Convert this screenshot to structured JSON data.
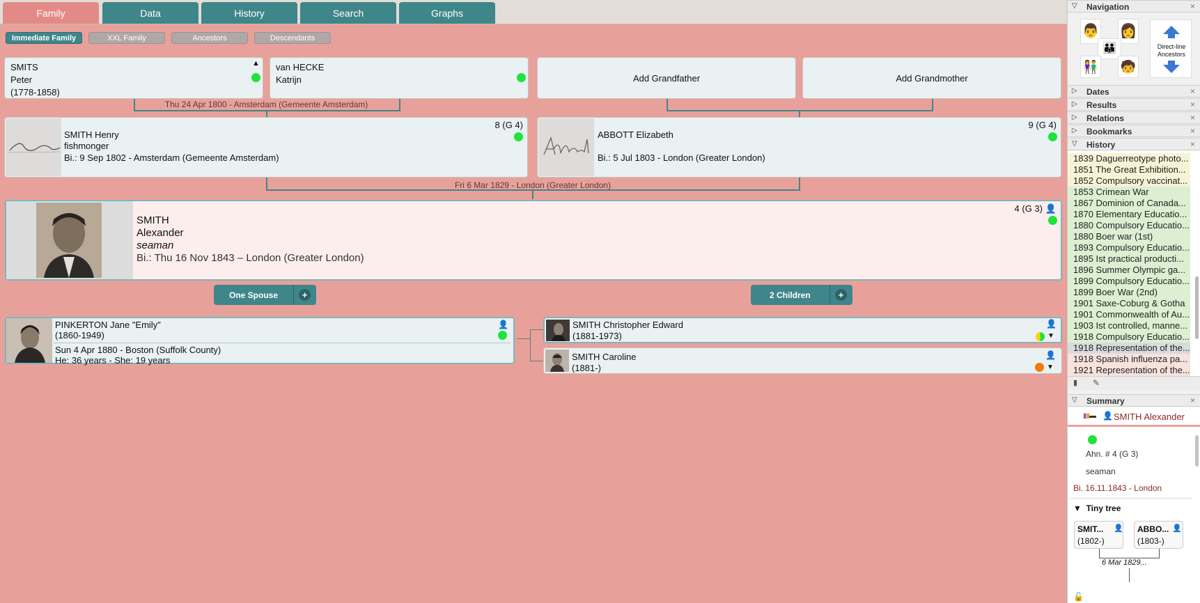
{
  "tabs": [
    "Family",
    "Data",
    "History",
    "Search",
    "Graphs"
  ],
  "subtabs": [
    "Immediate Family",
    "XXL Family",
    "Ancestors",
    "Descendants"
  ],
  "grandparents": {
    "paternal_grandfather": {
      "surname": "SMITS",
      "given": "Peter",
      "years": "(1778-1858)"
    },
    "paternal_grandmother": {
      "surname": "van HECKE",
      "given": "Katrijn"
    },
    "add_grandfather": "Add Grandfather",
    "add_grandmother": "Add Grandmother",
    "marriage": "Thu 24 Apr 1800 - Amsterdam (Gemeente Amsterdam)"
  },
  "father": {
    "name": "SMITH Henry",
    "occupation": "fishmonger",
    "birth": "Bi.: 9 Sep 1802 - Amsterdam (Gemeente Amsterdam)",
    "number": "8 (G 4)",
    "signature": "Smith"
  },
  "mother": {
    "name": "ABBOTT Elizabeth",
    "birth": "Bi.: 5 Jul 1803 - London (Greater London)",
    "number": "9 (G 4)",
    "signature": "Abbott"
  },
  "parents_marriage": "Fri 6 Mar 1829 - London (Greater London)",
  "focus": {
    "surname": "SMITH",
    "given": "Alexander",
    "occupation": "seaman",
    "birth": "Bi.: Thu 16 Nov 1843 – London (Greater London)",
    "number": "4 (G 3)"
  },
  "buttons": {
    "spouse": "One Spouse",
    "children": "2 Children",
    "plus": "+"
  },
  "spouse": {
    "name": "PINKERTON Jane \"Emily\"",
    "years": "(1860-1949)",
    "marriage": "Sun 4 Apr 1880 - Boston (Suffolk County)",
    "ages": "He: 36 years - She: 19 years"
  },
  "children": [
    {
      "name": "SMITH Christopher Edward",
      "years": "(1881-1973)"
    },
    {
      "name": "SMITH Caroline",
      "years": "(1881-)"
    }
  ],
  "side": {
    "navigation": "Navigation",
    "direct_line": "Direct-line Ancestors",
    "dates": "Dates",
    "results": "Results",
    "relations": "Relations",
    "bookmarks": "Bookmarks",
    "history": "History",
    "summary": "Summary",
    "history_items": [
      "1839 Daguerreotype photo...",
      "1851 The Great Exhibition...",
      "1852 Compulsory vaccinat...",
      "1853 Crimean War",
      "1867 Dominion of Canada...",
      "1870 Elementary Educatio...",
      "1880 Compulsory Educatio...",
      "1880 Boer war (1st)",
      "1893 Compulsory Educatio...",
      "1895 Ist practical producti...",
      "1896 Summer Olympic ga...",
      "1899 Compulsory Educatio...",
      "1899 Boer War (2nd)",
      "1901 Saxe-Coburg & Gotha",
      "1901 Commonwealth of Au...",
      "1903 Ist controlled, manne...",
      "1918 Compulsory Educatio...",
      "1918 Representation of the...",
      "1918 Spanish influenza pa...",
      "1921 Representation of the..."
    ],
    "summary_name": "SMITH Alexander",
    "summary_ahn": "Ahn. # 4 (G 3)",
    "summary_occ": "seaman",
    "summary_birth": "Bi. 16.11.1843 - London",
    "tiny_tree": "Tiny tree",
    "tiny_father": {
      "name": "SMIT...",
      "years": "(1802-)"
    },
    "tiny_mother": {
      "name": "ABBO...",
      "years": "(1803-)"
    },
    "tiny_marriage": "6 Mar 1829...",
    "close": "×"
  }
}
